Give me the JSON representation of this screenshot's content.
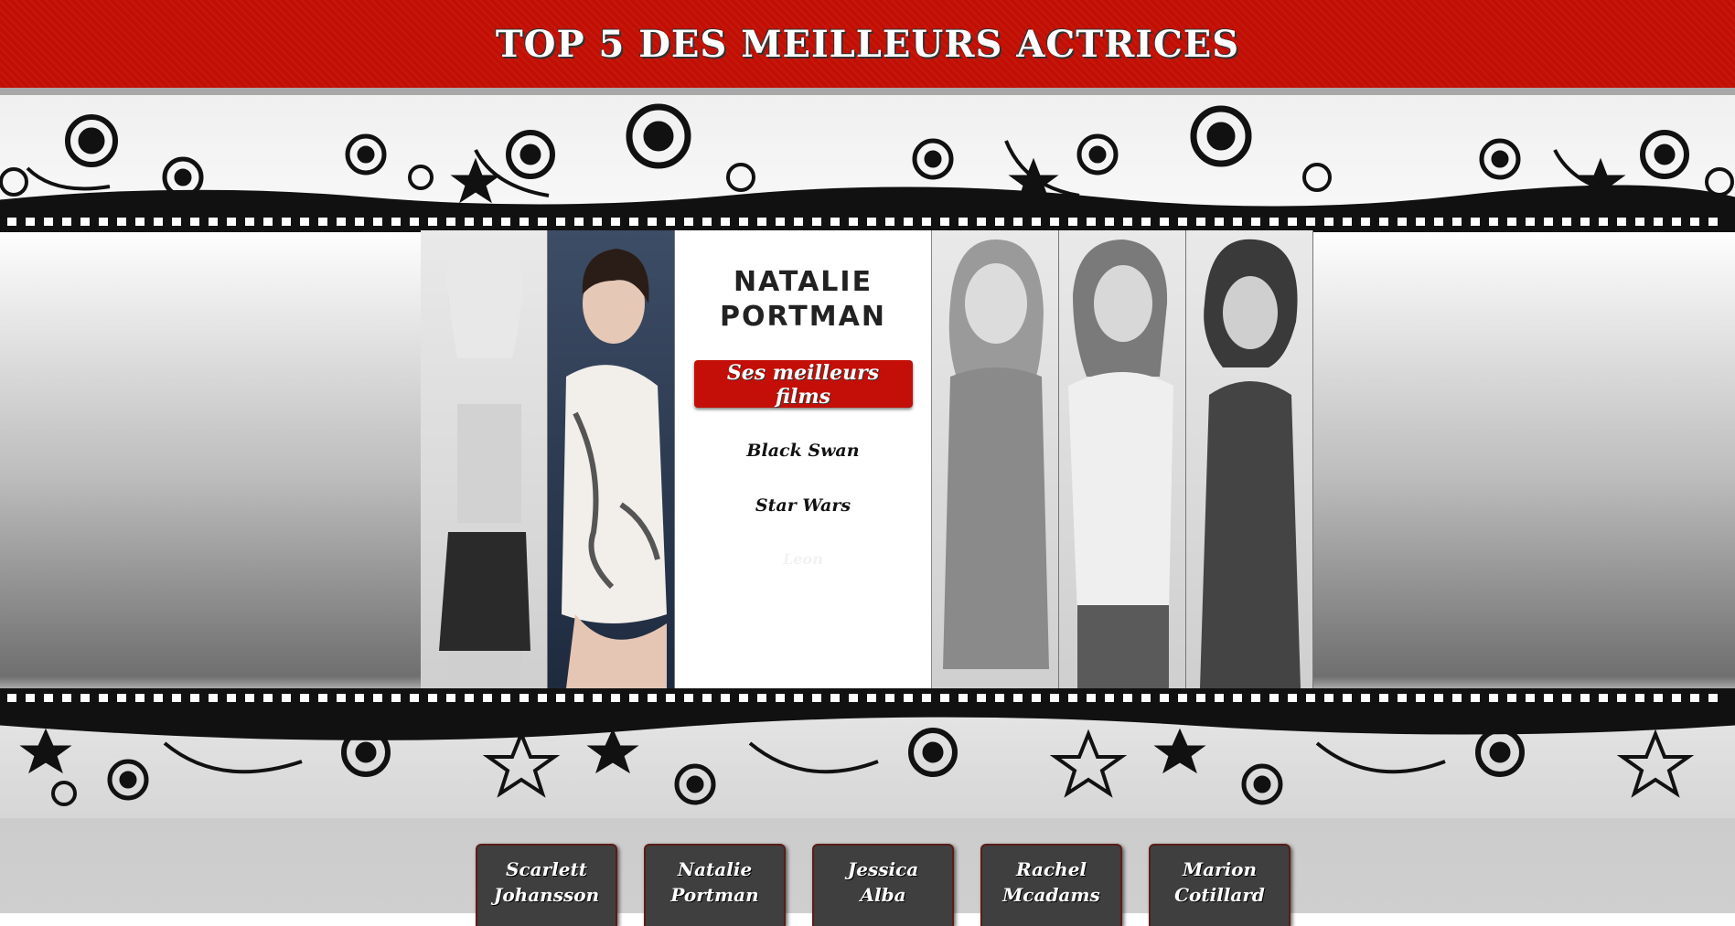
{
  "header": {
    "title": "TOP 5 DES MEILLEURS ACTRICES"
  },
  "featured": {
    "name_line1": "NATALIE",
    "name_line2": "PORTMAN",
    "films_button": "Ses meilleurs films",
    "films": [
      "Black Swan",
      "Star Wars",
      "Leon"
    ]
  },
  "actresses": [
    {
      "first": "Scarlett",
      "last": "Johansson"
    },
    {
      "first": "Natalie",
      "last": "Portman"
    },
    {
      "first": "Jessica",
      "last": "Alba"
    },
    {
      "first": "Rachel",
      "last": "Mcadams"
    },
    {
      "first": "Marion",
      "last": "Cotillard"
    }
  ],
  "colors": {
    "brand_red": "#c20f04",
    "button_dark": "#3f3f3f"
  },
  "icons": [
    "star-emblem-icon",
    "film-strip-icon"
  ]
}
